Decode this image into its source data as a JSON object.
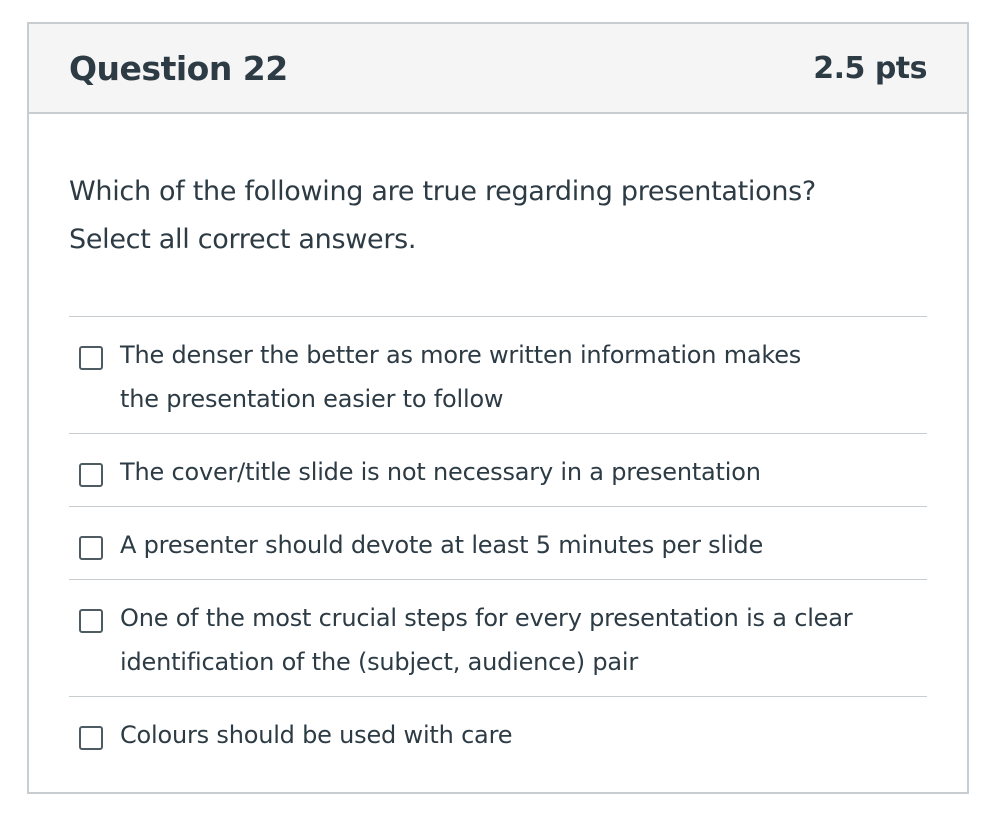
{
  "question": {
    "title": "Question 22",
    "points": "2.5 pts",
    "text_line1": "Which of the following are true regarding presentations?",
    "text_line2": "Select all correct answers."
  },
  "answers": [
    {
      "label": "The denser the better as more written information makes the presentation easier to follow",
      "checked": false
    },
    {
      "label": "The cover/title slide is not necessary in a presentation",
      "checked": false
    },
    {
      "label": "A presenter should devote at least 5 minutes per slide",
      "checked": false
    },
    {
      "label": "One of the most crucial steps for every presentation is a clear identification of the (subject, audience) pair",
      "checked": false
    },
    {
      "label": "Colours should be used with care",
      "checked": false
    }
  ],
  "colors": {
    "text": "#2d3b45",
    "header_bg": "#f5f5f5",
    "border": "#c7cdd1"
  }
}
